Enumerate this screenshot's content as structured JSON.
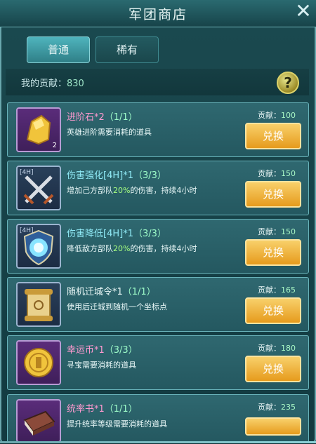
{
  "window": {
    "title": "军团商店",
    "close_glyph": "✕"
  },
  "tabs": [
    {
      "label": "普通",
      "active": true
    },
    {
      "label": "稀有",
      "active": false
    }
  ],
  "contribution": {
    "label": "我的贡献：",
    "value": "830"
  },
  "help": {
    "glyph": "?"
  },
  "items": [
    {
      "name": "进阶石*2",
      "qty": "（1/1）",
      "desc": "英雄进阶需要消耗的道具",
      "desc_hl": "",
      "contrib_label": "贡献：",
      "contrib_value": "100",
      "button": "兑换",
      "icon": "stone-icon",
      "badge": "",
      "count": "2",
      "name_color": "pink"
    },
    {
      "name": "伤害强化[4H]*1",
      "qty": "（3/3）",
      "desc": "增加己方部队20%的伤害，持续4小时",
      "desc_hl": "20%",
      "contrib_label": "贡献：",
      "contrib_value": "150",
      "button": "兑换",
      "icon": "crossed-swords-icon",
      "badge": "[4H]",
      "count": "",
      "name_color": "cyan"
    },
    {
      "name": "伤害降低[4H]*1",
      "qty": "（3/3）",
      "desc": "降低敌方部队20%的伤害，持续4小时",
      "desc_hl": "20%",
      "contrib_label": "贡献：",
      "contrib_value": "150",
      "button": "兑换",
      "icon": "vortex-shield-icon",
      "badge": "[4H]",
      "count": "",
      "name_color": "cyan"
    },
    {
      "name": "随机迁城令*1",
      "qty": "（1/1）",
      "desc": "使用后迁城到随机一个坐标点",
      "desc_hl": "",
      "contrib_label": "贡献：",
      "contrib_value": "165",
      "button": "兑换",
      "icon": "scroll-icon",
      "badge": "",
      "count": "",
      "name_color": "white"
    },
    {
      "name": "幸运币*1",
      "qty": "（3/3）",
      "desc": "寻宝需要消耗的道具",
      "desc_hl": "",
      "contrib_label": "贡献：",
      "contrib_value": "180",
      "button": "兑换",
      "icon": "coin-icon",
      "badge": "",
      "count": "",
      "name_color": "pink"
    },
    {
      "name": "统率书*1",
      "qty": "（1/1）",
      "desc": "提升统率等级需要消耗的道具",
      "desc_hl": "",
      "contrib_label": "贡献：",
      "contrib_value": "235",
      "button": "",
      "icon": "book-icon",
      "badge": "",
      "count": "",
      "name_color": "pink"
    }
  ],
  "colors": {
    "accent": "#e69b1d",
    "panel": "#2f6870",
    "name_pink": "#ff9ad0",
    "name_cyan": "#8fe9f5"
  }
}
